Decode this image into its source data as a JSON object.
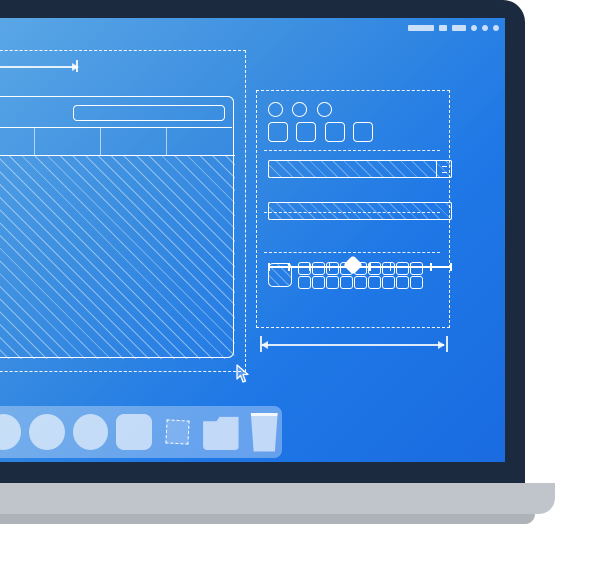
{
  "description": "Flat-style illustration of a laptop showing a UI-design wireframe / blueprint on screen. No readable text.",
  "colors": {
    "bezel": "#1b2a3e",
    "screen_gradient_from": "#5aa6e6",
    "screen_gradient_to": "#1a6be0",
    "laptop_base": "#c0c5cb",
    "wireframe_stroke": "#ffffff"
  }
}
